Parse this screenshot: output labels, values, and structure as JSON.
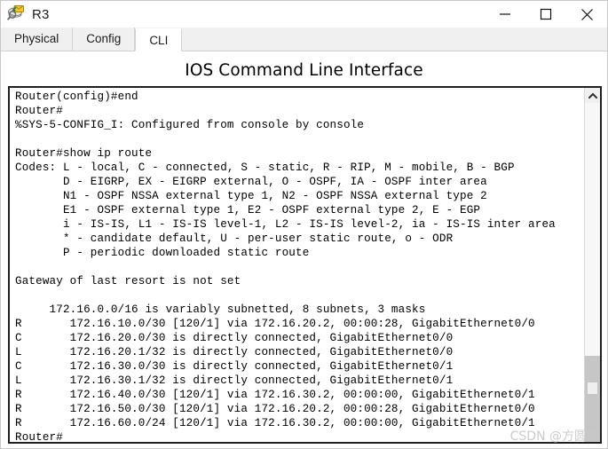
{
  "window": {
    "title": "R3",
    "icon": "router-device-icon",
    "controls": [
      {
        "name": "minimize-button",
        "glyph": "minimize-icon"
      },
      {
        "name": "maximize-button",
        "glyph": "maximize-icon"
      },
      {
        "name": "close-button",
        "glyph": "close-icon"
      }
    ]
  },
  "tabs": [
    {
      "label": "Physical",
      "active": false
    },
    {
      "label": "Config",
      "active": false
    },
    {
      "label": "CLI",
      "active": true
    }
  ],
  "heading": "IOS Command Line Interface",
  "terminal": {
    "lines": [
      "Router(config)#end",
      "Router#",
      "%SYS-5-CONFIG_I: Configured from console by console",
      "",
      "Router#show ip route",
      "Codes: L - local, C - connected, S - static, R - RIP, M - mobile, B - BGP",
      "       D - EIGRP, EX - EIGRP external, O - OSPF, IA - OSPF inter area",
      "       N1 - OSPF NSSA external type 1, N2 - OSPF NSSA external type 2",
      "       E1 - OSPF external type 1, E2 - OSPF external type 2, E - EGP",
      "       i - IS-IS, L1 - IS-IS level-1, L2 - IS-IS level-2, ia - IS-IS inter area",
      "       * - candidate default, U - per-user static route, o - ODR",
      "       P - periodic downloaded static route",
      "",
      "Gateway of last resort is not set",
      "",
      "     172.16.0.0/16 is variably subnetted, 8 subnets, 3 masks",
      "R       172.16.10.0/30 [120/1] via 172.16.20.2, 00:00:28, GigabitEthernet0/0",
      "C       172.16.20.0/30 is directly connected, GigabitEthernet0/0",
      "L       172.16.20.1/32 is directly connected, GigabitEthernet0/0",
      "C       172.16.30.0/30 is directly connected, GigabitEthernet0/1",
      "L       172.16.30.1/32 is directly connected, GigabitEthernet0/1",
      "R       172.16.40.0/30 [120/1] via 172.16.30.2, 00:00:00, GigabitEthernet0/1",
      "R       172.16.50.0/30 [120/1] via 172.16.20.2, 00:00:28, GigabitEthernet0/0",
      "R       172.16.60.0/24 [120/1] via 172.16.30.2, 00:00:00, GigabitEthernet0/1",
      "Router#"
    ]
  },
  "scrollbar": {
    "up_arrow": "chevron-up-icon"
  },
  "watermark": "CSDN @方圆脸",
  "colors": {
    "terminal_border": "#1f1f1f",
    "tab_active_bg": "#ffffff",
    "tabstrip_bg": "#f0f0f0",
    "scrollbar_thumb": "#c6c6c6",
    "text": "#000000",
    "watermark": "#c9c9c9"
  }
}
